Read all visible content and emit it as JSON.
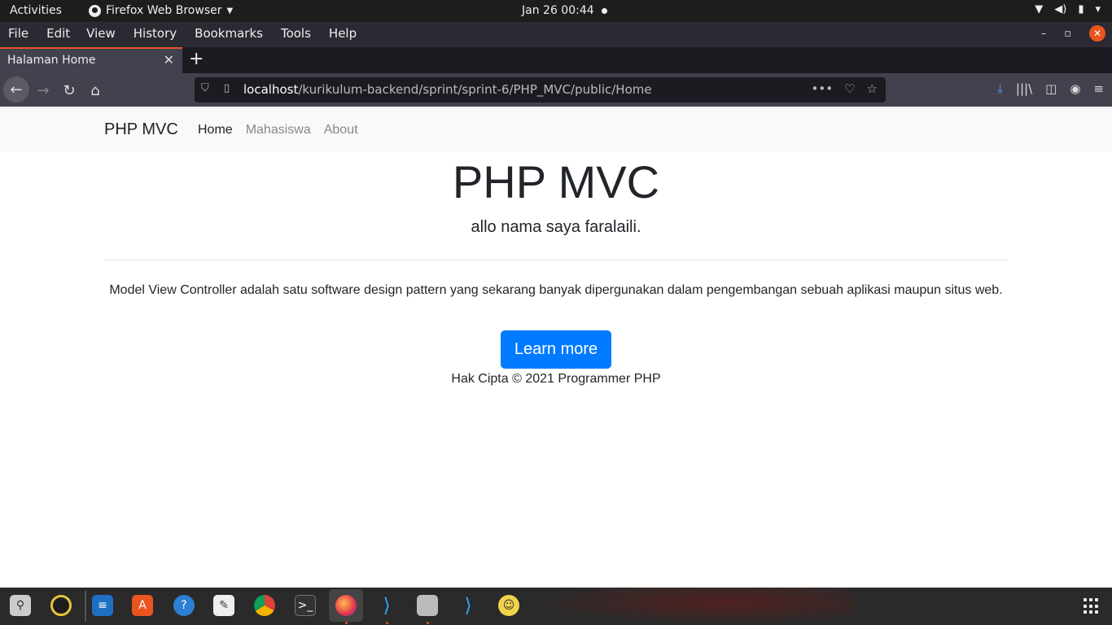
{
  "topbar": {
    "activities": "Activities",
    "app_name": "Firefox Web Browser",
    "clock": "Jan 26  00:44"
  },
  "menubar": {
    "items": [
      "File",
      "Edit",
      "View",
      "History",
      "Bookmarks",
      "Tools",
      "Help"
    ]
  },
  "tab": {
    "title": "Halaman Home"
  },
  "urlbar": {
    "host": "localhost",
    "path": "/kurikulum-backend/sprint/sprint-6/PHP_MVC/public/Home"
  },
  "site": {
    "brand": "PHP MVC",
    "nav": [
      "Home",
      "Mahasiswa",
      "About"
    ],
    "heading": "PHP MVC",
    "lead": "allo nama saya faralaili.",
    "description": "Model View Controller adalah satu software design pattern yang sekarang banyak dipergunakan dalam pengembangan sebuah aplikasi maupun situs web.",
    "button": "Learn more",
    "footer": "Hak Cipta © 2021 Programmer PHP"
  },
  "colors": {
    "accent": "#e95420",
    "primary_button": "#007bff"
  },
  "dock": {
    "icons": [
      "search-icon",
      "rhythmbox-icon",
      "writer-icon",
      "software-icon",
      "help-icon",
      "text-editor-icon",
      "chrome-icon",
      "terminal-icon",
      "firefox-icon",
      "vscode-icon",
      "files-icon",
      "vscode-icon",
      "php-icon"
    ]
  }
}
